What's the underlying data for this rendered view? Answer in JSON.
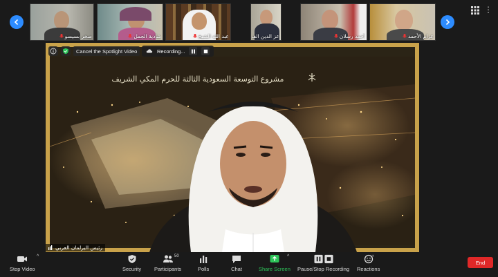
{
  "gallery": {
    "participants": [
      {
        "name": "صخر بسيسو"
      },
      {
        "name": "شادية الجمل"
      },
      {
        "name": "عبد الله الشيخ"
      },
      {
        "name": "عز الدين الفرجا"
      },
      {
        "name": "أحمد رسلان"
      },
      {
        "name": "عزام الأحمد"
      }
    ]
  },
  "spotlight": {
    "cancel_label": "Cancel the Spotlight Video",
    "recording_label": "Recording..."
  },
  "main_video": {
    "banner_text": "مشروع التوسعة السعودية الثالثة للحرم المكي الشريف",
    "speaker_name": "رئيس البرلمان العربي"
  },
  "toolbar": {
    "stop_video": "Stop Video",
    "security": "Security",
    "participants": "Participants",
    "participants_count": "50",
    "polls": "Polls",
    "chat": "Chat",
    "share_screen": "Share Screen",
    "pause_recording": "Pause/Stop Recording",
    "reactions": "Reactions",
    "end": "End"
  },
  "colors": {
    "accent_blue": "#2d8cff",
    "share_green": "#2ec55a",
    "end_red": "#e02828",
    "frame_gold": "#c9a24a"
  }
}
